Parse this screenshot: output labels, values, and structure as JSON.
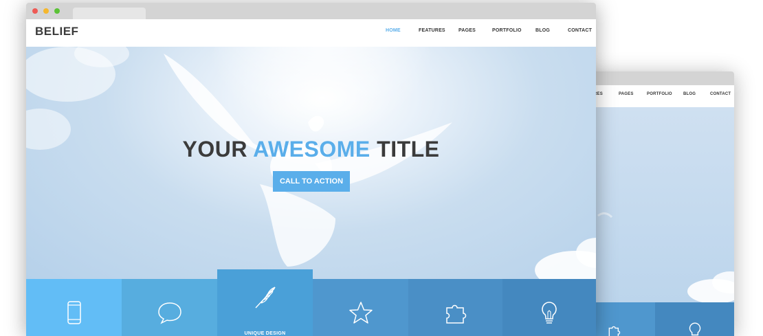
{
  "window": {
    "traffic_light_colors": [
      "#ee5a55",
      "#f5b72d",
      "#5bc236"
    ]
  },
  "site": {
    "logo": "BELIEF",
    "nav": [
      "HOME",
      "FEATURES",
      "PAGES",
      "PORTFOLIO",
      "BLOG",
      "CONTACT"
    ],
    "active_nav": "HOME"
  },
  "back_window": {
    "nav": [
      "RES",
      "PAGES",
      "PORTFOLIO",
      "BLOG",
      "CONTACT"
    ]
  },
  "hero": {
    "title_pre": "YOUR",
    "title_accent": "AWESOME",
    "title_post": "TITLE",
    "cta": "CALL TO ACTION"
  },
  "features": [
    {
      "icon": "phone-icon",
      "label": ""
    },
    {
      "icon": "chat-bubble-icon",
      "label": ""
    },
    {
      "icon": "feather-icon",
      "label": "UNIQUE DESIGN"
    },
    {
      "icon": "star-icon",
      "label": ""
    },
    {
      "icon": "puzzle-icon",
      "label": ""
    },
    {
      "icon": "lightbulb-icon",
      "label": ""
    }
  ],
  "colors": {
    "accent": "#5aaeea",
    "feature_tiles": [
      "#62bdf6",
      "#57addf",
      "#4aa0d8",
      "#4f97ce",
      "#4a8fc6",
      "#4488bf"
    ],
    "feature_active": "#4aa0d8"
  }
}
